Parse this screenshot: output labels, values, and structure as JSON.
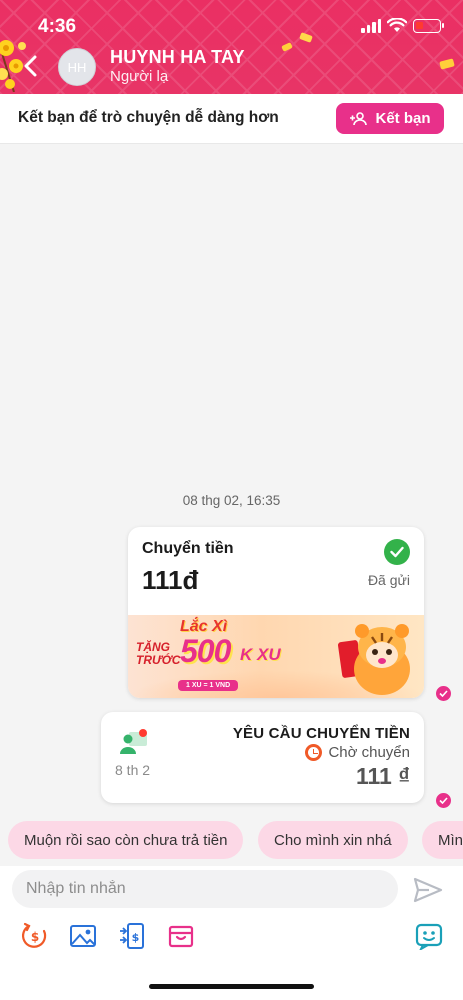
{
  "status": {
    "time": "4:36"
  },
  "header": {
    "name": "HUYNH HA TAY",
    "subtitle": "Người lạ",
    "avatar_initials": "HH"
  },
  "friend_bar": {
    "text": "Kết bạn để trò chuyện dễ dàng hơn",
    "button": "Kết bạn"
  },
  "chat": {
    "date": "08 thg 02, 16:35",
    "transfer": {
      "title": "Chuyển tiền",
      "amount": "111đ",
      "status": "Đã gửi",
      "banner": {
        "headline": "Lắc Xì",
        "line1": "TẶNG",
        "line2": "TRƯỚC",
        "amount": "500",
        "unit": "K XU",
        "rate": "1 XU = 1 VND"
      }
    },
    "request": {
      "title": "YÊU CẦU CHUYỂN TIỀN",
      "status": "Chờ chuyển",
      "amount": "111 ₫",
      "date": "8 th 2"
    }
  },
  "quick_replies": [
    "Muộn rồi sao còn chưa trả tiền",
    "Cho mình xin nhá",
    "Mìn"
  ],
  "composer": {
    "placeholder": "Nhập tin nhắn"
  },
  "colors": {
    "brand": "#e8308a",
    "header": "#ea2f63",
    "success": "#33b24a"
  }
}
